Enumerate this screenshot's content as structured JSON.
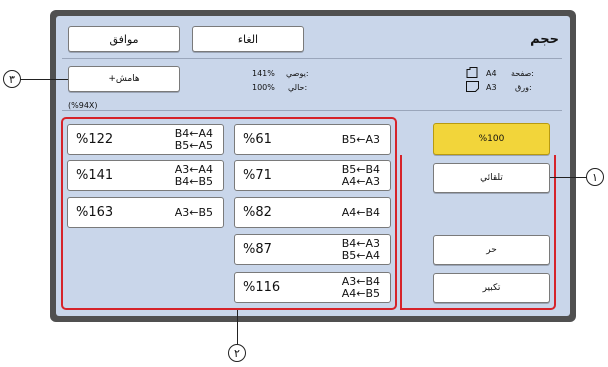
{
  "header": {
    "title": "حجم",
    "ok_label": "موافق",
    "cancel_label": "الغاء"
  },
  "info": {
    "page_label": "صفحة:",
    "page_value": "A4",
    "paper_label": "ورق:",
    "paper_value": "A3",
    "recommended_label": "يوصي:",
    "recommended_value": "141%",
    "current_label": "حالي:",
    "current_value": "100%",
    "margin_button": "+هامش",
    "margin_note": "(%94X)"
  },
  "right_buttons": {
    "full": "%100",
    "auto": "تلقائي",
    "free": "حر",
    "zoom": "تكبير"
  },
  "ratios": [
    {
      "pct": "%61",
      "line1": "B5←A3"
    },
    {
      "pct": "%71",
      "line1": "B5←B4",
      "line2": "A4←A3"
    },
    {
      "pct": "%82",
      "line1": "A4←B4"
    },
    {
      "pct": "%87",
      "line1": "B4←A3",
      "line2": "B5←A4"
    },
    {
      "pct": "%116",
      "line1": "A3←B4",
      "line2": "A4←B5"
    },
    {
      "pct": "%122",
      "line1": "B4←A4",
      "line2": "B5←A5"
    },
    {
      "pct": "%141",
      "line1": "A3←A4",
      "line2": "B4←B5"
    },
    {
      "pct": "%163",
      "line1": "A3←B5"
    }
  ],
  "callouts": {
    "one": "١",
    "two": "٢",
    "three": "٣"
  },
  "colors": {
    "frame": "#505050",
    "panel": "#c9d6ea",
    "selected": "#f2d53a",
    "highlight": "#d6232a"
  },
  "icons": {
    "page": "page-orientation-icon",
    "paper": "paper-orientation-icon"
  }
}
